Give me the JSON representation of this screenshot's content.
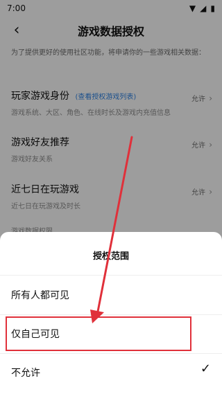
{
  "status_bar": {
    "time": "7:00",
    "icons": [
      "gear-icon",
      "shield-icon",
      "wifi-icon",
      "signal-icon",
      "battery-icon"
    ]
  },
  "header": {
    "title": "游戏数据授权",
    "back_icon": "back-chevron-icon"
  },
  "intro": "为了提供更好的使用社区功能，将申请你的一些游戏相关数据：",
  "rows": [
    {
      "title": "玩家游戏身份",
      "link": "(查看授权游戏列表)",
      "subtitle": "游戏系统、大区、角色、在线时长及游戏内充值信息",
      "status": "允许"
    },
    {
      "title": "游戏好友推荐",
      "subtitle": "游戏好友关系",
      "status": "允许"
    },
    {
      "title": "近七日在玩游戏",
      "subtitle": "近七日在玩游戏及时长",
      "status": "允许"
    }
  ],
  "footer_hint": "游戏数据权限",
  "sheet": {
    "title": "授权范围",
    "options": [
      {
        "label": "所有人都可见",
        "selected": false
      },
      {
        "label": "仅自己可见",
        "selected": false
      },
      {
        "label": "不允许",
        "selected": true
      }
    ]
  },
  "colors": {
    "highlight": "#e0303a",
    "link": "#2b7cd8",
    "overlay": "rgba(0,0,0,0.35)"
  }
}
